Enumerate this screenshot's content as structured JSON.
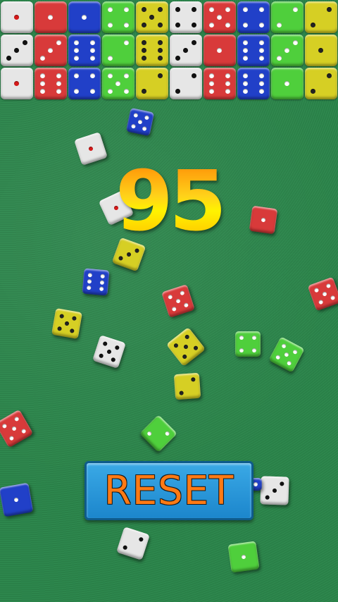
{
  "score": "95",
  "reset_label": "RESET",
  "colors": {
    "felt": "#2b8349",
    "white": "#e6e6e6",
    "red": "#d83a3a",
    "blue": "#2140c8",
    "green": "#4fcf3c",
    "yellow": "#d6cf24",
    "button": "#1c86cc",
    "button_text": "#ff7a14",
    "score_text": "#ffd21a"
  },
  "tray": [
    {
      "color": "white",
      "value": 1
    },
    {
      "color": "red",
      "value": 1
    },
    {
      "color": "blue",
      "value": 1
    },
    {
      "color": "green",
      "value": 4
    },
    {
      "color": "yellow",
      "value": 5
    },
    {
      "color": "white",
      "value": 4
    },
    {
      "color": "red",
      "value": 5
    },
    {
      "color": "blue",
      "value": 4
    },
    {
      "color": "green",
      "value": 2
    },
    {
      "color": "yellow",
      "value": 2
    },
    {
      "color": "white",
      "value": 3
    },
    {
      "color": "red",
      "value": 3
    },
    {
      "color": "blue",
      "value": 6
    },
    {
      "color": "green",
      "value": 2
    },
    {
      "color": "yellow",
      "value": 6
    },
    {
      "color": "white",
      "value": 3
    },
    {
      "color": "red",
      "value": 1
    },
    {
      "color": "blue",
      "value": 6
    },
    {
      "color": "green",
      "value": 3
    },
    {
      "color": "yellow",
      "value": 1
    },
    {
      "color": "white",
      "value": 1
    },
    {
      "color": "red",
      "value": 6
    },
    {
      "color": "blue",
      "value": 4
    },
    {
      "color": "green",
      "value": 5
    },
    {
      "color": "yellow",
      "value": 2
    },
    {
      "color": "white",
      "value": 2
    },
    {
      "color": "red",
      "value": 6
    },
    {
      "color": "blue",
      "value": 6
    },
    {
      "color": "green",
      "value": 1
    },
    {
      "color": "yellow",
      "value": 2
    }
  ],
  "table_dice": [
    {
      "color": "blue",
      "value": 5
    },
    {
      "color": "white",
      "value": 1
    },
    {
      "color": "white",
      "value": 1
    },
    {
      "color": "yellow",
      "value": 3
    },
    {
      "color": "blue",
      "value": 6
    },
    {
      "color": "red",
      "value": 5
    },
    {
      "color": "red",
      "value": 1
    },
    {
      "color": "red",
      "value": 5
    },
    {
      "color": "yellow",
      "value": 5
    },
    {
      "color": "white",
      "value": 5
    },
    {
      "color": "yellow",
      "value": 5
    },
    {
      "color": "green",
      "value": 4
    },
    {
      "color": "green",
      "value": 5
    },
    {
      "color": "yellow",
      "value": 2
    },
    {
      "color": "red",
      "value": 5
    },
    {
      "color": "green",
      "value": 2
    },
    {
      "color": "blue",
      "value": 1
    },
    {
      "color": "white",
      "value": 3
    },
    {
      "color": "white",
      "value": 2
    },
    {
      "color": "green",
      "value": 1
    },
    {
      "color": "blue",
      "value": 1
    }
  ]
}
